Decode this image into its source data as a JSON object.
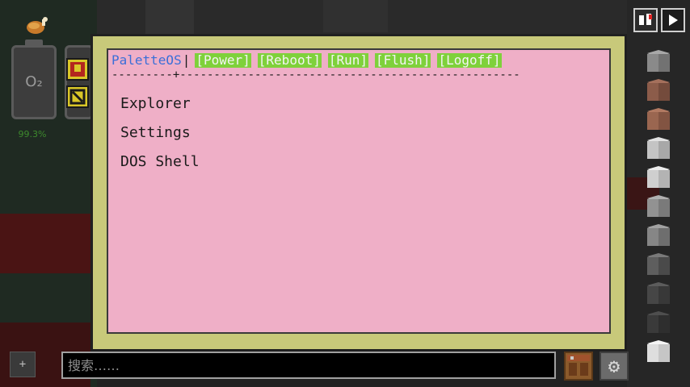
{
  "screen": {
    "brand": "PaletteOS",
    "separator": "|",
    "menu_buttons": [
      {
        "label": "[Power]"
      },
      {
        "label": "[Reboot]"
      },
      {
        "label": "[Run]"
      },
      {
        "label": "[Flush]"
      },
      {
        "label": "[Logoff]"
      }
    ],
    "rule_text": "---------+--------------------------------------------------",
    "items": [
      {
        "label": "Explorer"
      },
      {
        "label": "Settings"
      },
      {
        "label": "DOS Shell"
      }
    ]
  },
  "hud": {
    "oxygen_label": "O₂",
    "oxygen_percent": "99.3%"
  },
  "bottom": {
    "search_placeholder": "搜索……"
  },
  "colors": {
    "screen_background": "#efafc7",
    "frame": "#c8c97a",
    "brand_text": "#3b6fd8",
    "menu_button_bg": "#7fd13b",
    "oxygen_percent_text": "#3d8a2d"
  },
  "icons": {
    "food": "roast-chicken-icon",
    "oxygen_tank": "oxygen-tank-icon",
    "players": "players-icon",
    "next": "play-arrow-icon",
    "crafting": "crafting-table-icon",
    "settings": "gear-icon"
  },
  "right_strip_blocks": [
    "stone-block",
    "granite-block",
    "polished-granite-block",
    "diorite-block",
    "polished-diorite-block",
    "andesite-block",
    "polished-andesite-block",
    "cobblestone-block",
    "mossy-block",
    "deepslate-block",
    "white-block"
  ]
}
